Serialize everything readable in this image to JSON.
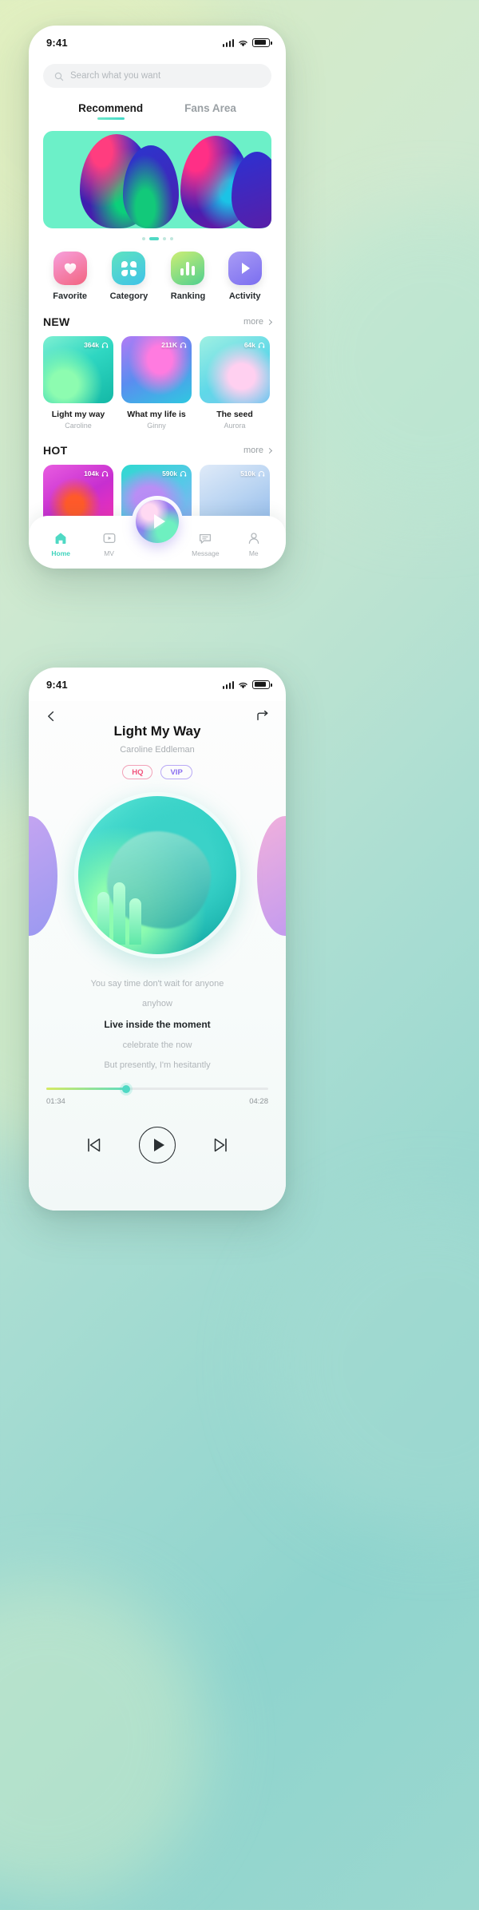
{
  "home": {
    "status": {
      "time": "9:41",
      "signal_icon": "signal-bars-icon",
      "wifi_icon": "wifi-icon",
      "battery_icon": "battery-icon"
    },
    "search": {
      "placeholder": "Search what you want",
      "value": "",
      "icon": "search-icon"
    },
    "tabs": [
      {
        "label": "Recommend",
        "active": true
      },
      {
        "label": "Fans Area",
        "active": false
      }
    ],
    "carousel": {
      "dots": 4,
      "active_index": 1
    },
    "quick_actions": [
      {
        "label": "Favorite",
        "icon": "heart-icon"
      },
      {
        "label": "Category",
        "icon": "grid-icon"
      },
      {
        "label": "Ranking",
        "icon": "bar-chart-icon"
      },
      {
        "label": "Activity",
        "icon": "play-badge-icon"
      }
    ],
    "sections": [
      {
        "title": "NEW",
        "more_label": "more",
        "items": [
          {
            "plays": "364k",
            "title": "Light my way",
            "artist": "Caroline",
            "art": "art-lmw"
          },
          {
            "plays": "211K",
            "title": "What my life is",
            "artist": "Ginny",
            "art": "art-wml"
          },
          {
            "plays": "64k",
            "title": "The seed",
            "artist": "Aurora",
            "art": "art-seed"
          }
        ]
      },
      {
        "title": "HOT",
        "more_label": "more",
        "items": [
          {
            "plays": "104k",
            "title": "",
            "artist": "",
            "art": "art-h1"
          },
          {
            "plays": "590k",
            "title": "",
            "artist": "",
            "art": "art-h2"
          },
          {
            "plays": "510k",
            "title": "",
            "artist": "",
            "art": "art-h3"
          }
        ]
      }
    ],
    "nav": {
      "items": [
        {
          "label": "Home",
          "icon": "home-icon",
          "active": true
        },
        {
          "label": "MV",
          "icon": "video-icon",
          "active": false
        },
        {
          "label": "Message",
          "icon": "message-icon",
          "active": false
        },
        {
          "label": "Me",
          "icon": "person-icon",
          "active": false
        }
      ],
      "fab": {
        "icon": "play-icon"
      }
    }
  },
  "player": {
    "status": {
      "time": "9:41",
      "signal_icon": "signal-bars-icon",
      "wifi_icon": "wifi-icon",
      "battery_icon": "battery-icon"
    },
    "back_icon": "chevron-left-icon",
    "share_icon": "share-arrow-icon",
    "title": "Light My Way",
    "artist": "Caroline Eddleman",
    "badges": [
      {
        "label": "HQ",
        "color": "#f2547d"
      },
      {
        "label": "VIP",
        "color": "#8a6ef0"
      }
    ],
    "lyrics": [
      {
        "text": "You say time don't wait for anyone",
        "current": false
      },
      {
        "text": "anyhow",
        "current": false
      },
      {
        "text": "Live inside the moment",
        "current": true
      },
      {
        "text": "celebrate the now",
        "current": false
      },
      {
        "text": "But presently, I'm hesitantly",
        "current": false
      }
    ],
    "progress": {
      "current_time": "01:34",
      "total_time": "04:28",
      "percent": 36
    },
    "controls": [
      {
        "name": "previous",
        "icon": "skip-back-icon"
      },
      {
        "name": "play",
        "icon": "play-icon"
      },
      {
        "name": "next",
        "icon": "skip-forward-icon"
      }
    ]
  },
  "colors": {
    "accent": "#4fd9c4",
    "accent2": "#6ee7c8",
    "hq": "#f2547d",
    "vip": "#8a6ef0"
  }
}
